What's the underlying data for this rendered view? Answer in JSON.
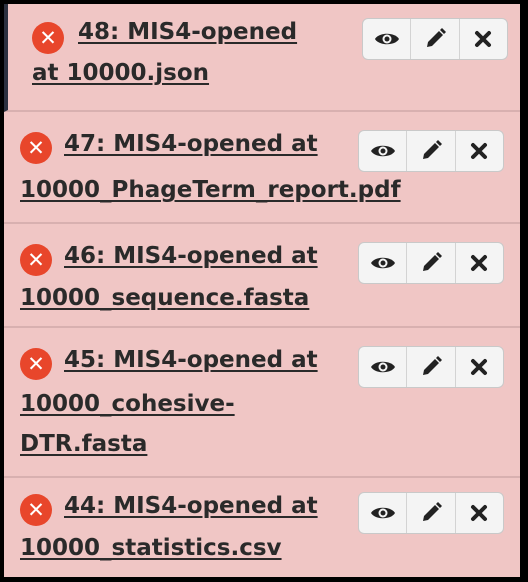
{
  "history_items": [
    {
      "line1": "48: MIS4-opened",
      "line2": "at 10000.json",
      "line3": ""
    },
    {
      "line1": "47: MIS4-opened at",
      "line2": "10000_PhageTerm_report.pdf",
      "line3": ""
    },
    {
      "line1": "46: MIS4-opened at",
      "line2": "10000_sequence.fasta",
      "line3": ""
    },
    {
      "line1": "45: MIS4-opened at",
      "line2": "10000_cohesive-",
      "line3": "DTR.fasta"
    },
    {
      "line1": "44: MIS4-opened at",
      "line2": "10000_statistics.csv",
      "line3": ""
    }
  ],
  "icons": {
    "error": "error-x-circle-icon",
    "view": "eye-icon",
    "edit": "pencil-icon",
    "delete": "close-x-icon"
  },
  "colors": {
    "item_background": "#f0c6c5",
    "error_icon": "#e8462b"
  }
}
